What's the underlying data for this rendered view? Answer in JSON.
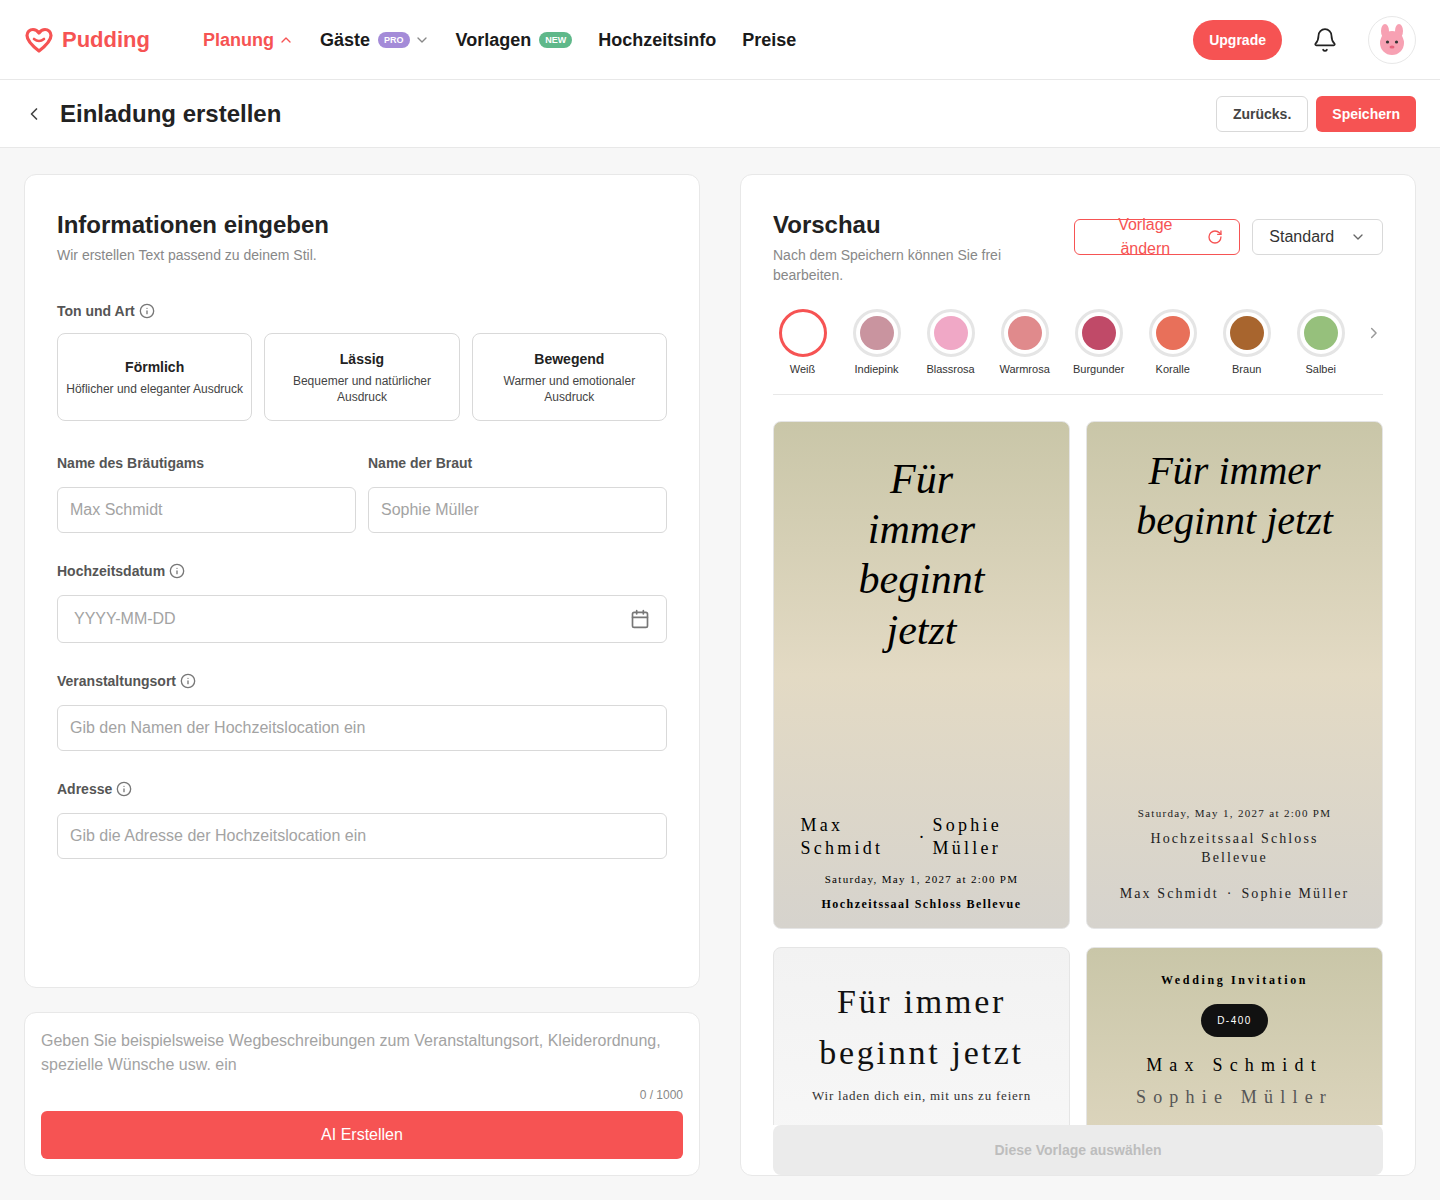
{
  "header": {
    "logo": "Pudding",
    "nav": [
      {
        "label": "Planung",
        "selected": true,
        "kind": "menu",
        "expanded": true
      },
      {
        "label": "Gäste",
        "selected": false,
        "kind": "menu",
        "expanded": false,
        "badge": "PRO",
        "badge_color": "#a48bd8"
      },
      {
        "label": "Vorlagen",
        "selected": false,
        "kind": "link",
        "badge": "NEW",
        "badge_color": "#5fb88a"
      },
      {
        "label": "Hochzeitsinfo",
        "selected": false,
        "kind": "link"
      },
      {
        "label": "Preise",
        "selected": false,
        "kind": "link"
      }
    ],
    "upgrade": "Upgrade"
  },
  "page": {
    "title": "Einladung erstellen",
    "buttons": [
      {
        "label": "Zurücks.",
        "kind": "outline"
      },
      {
        "label": "Speichern",
        "kind": "primary"
      }
    ]
  },
  "form": {
    "title": "Informationen eingeben",
    "subtitle": "Wir erstellen Text passend zu deinem Stil.",
    "tone_label": "Ton und Art",
    "tone_info": true,
    "tones": [
      {
        "title": "Förmlich",
        "description": "Höflicher und eleganter Ausdruck",
        "selected": false
      },
      {
        "title": "Lässig",
        "description": "Bequemer und natürlicher Ausdruck",
        "selected": false
      },
      {
        "title": "Bewegend",
        "description": "Warmer und emotionaler Ausdruck",
        "selected": false
      }
    ],
    "name_fields": [
      {
        "label": "Name des Bräutigams",
        "placeholder": "Max Schmidt",
        "info": false
      },
      {
        "label": "Name der Braut",
        "placeholder": "Sophie Müller",
        "info": false
      }
    ],
    "fields": [
      {
        "label": "Hochzeitsdatum",
        "placeholder": "YYYY-MM-DD",
        "info": true,
        "kind": "date"
      },
      {
        "label": "Veranstaltungsort",
        "placeholder": "Gib den Namen der Hochzeitslocation ein",
        "info": true,
        "kind": "text"
      },
      {
        "label": "Adresse",
        "placeholder": "Gib die Adresse der Hochzeitslocation ein",
        "info": true,
        "kind": "text"
      }
    ],
    "notes": {
      "placeholder": "Geben Sie beispielsweise Wegbeschreibungen zum Veranstaltungsort, Kleiderordnung, spezielle Wünsche usw. ein",
      "counter": "0 / 1000"
    },
    "generate_button": "AI Erstellen"
  },
  "preview": {
    "title": "Vorschau",
    "subtitle": "Nach dem Speichern können Sie frei bearbeiten.",
    "change_template": "Vorlage ändern",
    "dropdown": "Standard",
    "colors": [
      {
        "label": "Weiß",
        "color": "#ffffff",
        "selected": true
      },
      {
        "label": "Indiepink",
        "color": "#c9949f",
        "selected": false
      },
      {
        "label": "Blassrosa",
        "color": "#f0a8c6",
        "selected": false
      },
      {
        "label": "Warmrosa",
        "color": "#e08a8c",
        "selected": false
      },
      {
        "label": "Burgunder",
        "color": "#c04a68",
        "selected": false
      },
      {
        "label": "Koralle",
        "color": "#e8705a",
        "selected": false
      },
      {
        "label": "Braun",
        "color": "#a8652e",
        "selected": false
      },
      {
        "label": "Salbei",
        "color": "#96c07c",
        "selected": false
      }
    ],
    "templates": [
      {
        "kind": "script-stacked",
        "selected": false,
        "title": "Für immer beginnt jetzt",
        "groom": "Max Schmidt",
        "separator": "·",
        "bride": "Sophie Müller",
        "date": "Saturday, May 1, 2027 at 2:00 PM",
        "venue": "Hochzeitssaal Schloss Bellevue"
      },
      {
        "kind": "script-wide",
        "selected": false,
        "title": "Für immer beginnt jetzt",
        "date": "Saturday, May 1, 2027 at 2:00 PM",
        "venue": "Hochzeitssaal Schloss Bellevue",
        "groom": "Max Schmidt",
        "separator": "·",
        "bride": "Sophie Müller"
      },
      {
        "kind": "plain",
        "selected": false,
        "title": "Für immer beginnt jetzt",
        "subtitle": "Wir laden dich ein, mit uns zu feiern"
      },
      {
        "kind": "countdown",
        "selected": false,
        "label": "Wedding Invitation",
        "countdown": "D-400",
        "groom": "Max Schmidt",
        "bride": "Sophie Müller"
      }
    ],
    "select_button": {
      "label": "Diese Vorlage auswählen",
      "disabled": true
    }
  }
}
